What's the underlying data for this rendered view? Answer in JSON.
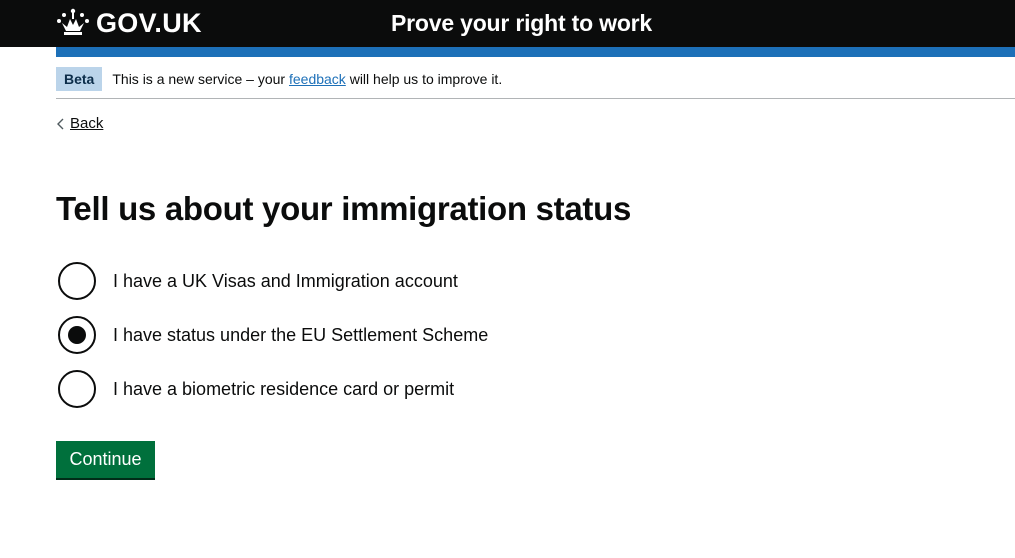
{
  "header": {
    "logo_text": "GOV.UK",
    "service_name": "Prove your right to work",
    "logo_icon": "crown-icon"
  },
  "phase_banner": {
    "tag": "Beta",
    "text_before": "This is a new service – your ",
    "link_text": "feedback",
    "text_after": " will help us to improve it."
  },
  "back_link": {
    "label": "Back",
    "icon": "chevron-left-icon"
  },
  "page": {
    "title": "Tell us about your immigration status"
  },
  "radios": {
    "selected_index": 1,
    "options": [
      {
        "label": "I have a UK Visas and Immigration account",
        "checked": false
      },
      {
        "label": "I have status under the EU Settlement Scheme",
        "checked": true
      },
      {
        "label": "I have a biometric residence card or permit",
        "checked": false
      }
    ]
  },
  "actions": {
    "continue_label": "Continue"
  },
  "colors": {
    "header_bg": "#0b0c0c",
    "header_bar": "#1d70b8",
    "phase_tag_bg": "#bbd4ea",
    "link": "#1d70b8",
    "button_bg": "#00703c"
  }
}
